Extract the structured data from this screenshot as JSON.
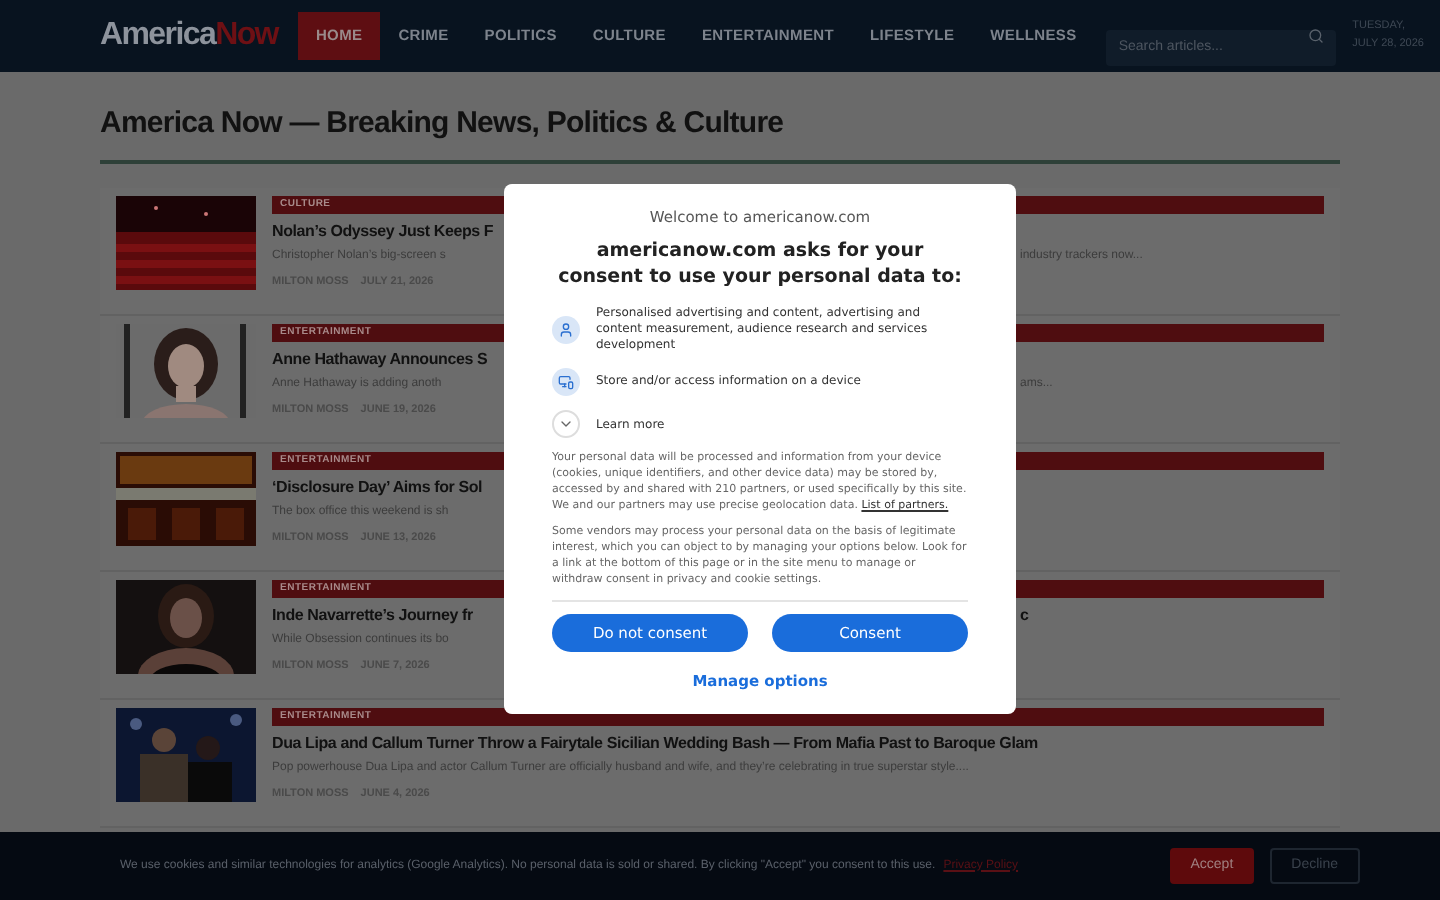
{
  "header": {
    "logo": {
      "first": "America",
      "second": "Now"
    },
    "nav": [
      {
        "label": "HOME",
        "selected": true
      },
      {
        "label": "CRIME",
        "selected": false
      },
      {
        "label": "POLITICS",
        "selected": false
      },
      {
        "label": "CULTURE",
        "selected": false
      },
      {
        "label": "ENTERTAINMENT",
        "selected": false
      },
      {
        "label": "LIFESTYLE",
        "selected": false
      },
      {
        "label": "WELLNESS",
        "selected": false
      }
    ],
    "search": {
      "placeholder": "Search articles..."
    },
    "date": [
      "TUESDAY,",
      "JULY 28, 2026"
    ]
  },
  "page_title": "America Now — Breaking News, Politics & Culture",
  "articles": [
    {
      "category": "CULTURE",
      "title": "Nolan’s Odyssey Just Keeps F",
      "excerpt": "Christopher Nolan’s big-screen s",
      "excerpt_tail": "industry trackers now...",
      "author": "MILTON MOSS",
      "date": "JULY 21, 2026"
    },
    {
      "category": "ENTERTAINMENT",
      "title": "Anne Hathaway Announces S",
      "excerpt": "Anne Hathaway is adding anoth",
      "excerpt_tail": "ams...",
      "author": "MILTON MOSS",
      "date": "JUNE 19, 2026"
    },
    {
      "category": "ENTERTAINMENT",
      "title": "‘Disclosure Day’ Aims for Sol",
      "excerpt": "The box office this weekend is sh",
      "author": "MILTON MOSS",
      "date": "JUNE 13, 2026"
    },
    {
      "category": "ENTERTAINMENT",
      "title": "Inde Navarrette’s Journey fr",
      "title_tail": "c",
      "excerpt": "While Obsession continues its bo",
      "author": "MILTON MOSS",
      "date": "JUNE 7, 2026"
    },
    {
      "category": "ENTERTAINMENT",
      "title": "Dua Lipa and Callum Turner Throw a Fairytale Sicilian Wedding Bash — From Mafia Past to Baroque Glam",
      "excerpt": "Pop powerhouse Dua Lipa and actor Callum Turner are officially husband and wife, and they’re celebrating in true superstar style....",
      "author": "MILTON MOSS",
      "date": "JUNE 4, 2026"
    }
  ],
  "consent_dialog": {
    "welcome": "Welcome to americanow.com",
    "heading": "americanow.com asks for your consent to use your personal data to:",
    "purposes": [
      {
        "kind": "person",
        "text": "Personalised advertising and content, advertising and content measurement, audience research and services development"
      },
      {
        "kind": "device",
        "text": "Store and/or access information on a device"
      }
    ],
    "learn_more": {
      "label": "Learn more",
      "expanded": false
    },
    "paragraph_1": "Your personal data will be processed and information from your device (cookies, unique identifiers, and other device data) may be stored by, accessed by and shared with 210 partners, or used specifically by this site. We and our partners may use precise geolocation data.",
    "partners_link": "List of partners.",
    "paragraph_2": "Some vendors may process your personal data on the basis of legitimate interest, which you can object to by managing your options below. Look for a link at the bottom of this page or in the site menu to manage or withdraw consent in privacy and cookie settings.",
    "buttons": [
      "Do not consent",
      "Consent"
    ],
    "manage": "Manage options"
  },
  "cookie_bar": {
    "text": "We use cookies and similar technologies for analytics (Google Analytics). No personal data is sold or shared. By clicking \"Accept\" you consent to this use.",
    "link": "Privacy Policy",
    "accept": "Accept",
    "decline": "Decline"
  }
}
